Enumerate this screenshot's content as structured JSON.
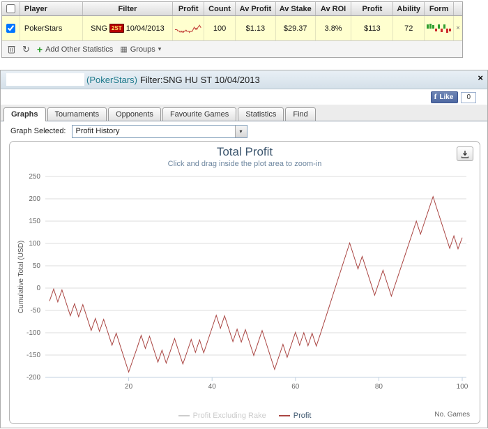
{
  "table": {
    "headers": [
      "",
      "Player",
      "Filter",
      "Profit",
      "Count",
      "Av Profit",
      "Av Stake",
      "Av ROI",
      "Profit",
      "Ability",
      "Form",
      ""
    ],
    "row": {
      "player": "PokerStars",
      "filter_prefix": "SNG",
      "filter_badge": "2ST",
      "filter_date": "10/04/2013",
      "count": "100",
      "av_profit": "$1.13",
      "av_stake": "$29.37",
      "av_roi": "3.8%",
      "profit": "$113",
      "ability": "72",
      "remove_label": "×",
      "form_bars": [
        6,
        7,
        5,
        -4,
        6,
        -5,
        6,
        -6,
        -4
      ]
    },
    "toolbar": {
      "refresh_icon": "↻",
      "groups_icon": "▦",
      "caret_icon": "▾",
      "plus_icon": "+",
      "add_label": "Add Other Statistics",
      "groups_label": "Groups"
    }
  },
  "window": {
    "title_site": "(PokerStars)",
    "title_filter": "Filter:SNG HU ST 10/04/2013",
    "close_label": "×",
    "like_f": "f",
    "like_label": "Like",
    "like_count": "0",
    "tabs": [
      "Graphs",
      "Tournaments",
      "Opponents",
      "Favourite Games",
      "Statistics",
      "Find"
    ],
    "graph_selected_label": "Graph Selected:",
    "graph_selected_value": "Profit History",
    "dropdown_arrow": "▾"
  },
  "colors": {
    "chart_line": "#AA4643",
    "hidden_legend": "#cccccc",
    "row_highlight": "#ffffcf",
    "title_teal": "#3E576F",
    "form_green": "#2f9e2f",
    "form_red": "#cc2a2a"
  },
  "chart_data": {
    "type": "line",
    "title": "Total Profit",
    "subtitle": "Click and drag inside the plot area to zoom-in",
    "ylabel": "Cumulative Total (USD)",
    "xlabel": "No. Games",
    "ylim": [
      -200,
      250
    ],
    "xlim": [
      0,
      101
    ],
    "yticks": [
      -200,
      -150,
      -100,
      -50,
      0,
      50,
      100,
      150,
      200,
      250
    ],
    "xticks": [
      20,
      40,
      60,
      80,
      100
    ],
    "grid": true,
    "legend_position": "bottom",
    "legend": [
      {
        "name": "Profit Excluding Rake",
        "color": "#cccccc",
        "hidden": true
      },
      {
        "name": "Profit",
        "color": "#AA4643",
        "hidden": false
      }
    ],
    "series": [
      {
        "name": "Profit",
        "color": "#AA4643",
        "x_start": 1,
        "x_step": 1,
        "values": [
          -29,
          -2,
          -31,
          -4,
          -33,
          -62,
          -35,
          -64,
          -37,
          -66,
          -95,
          -68,
          -97,
          -70,
          -99,
          -128,
          -101,
          -130,
          -159,
          -188,
          -161,
          -134,
          -106,
          -135,
          -108,
          -137,
          -166,
          -139,
          -168,
          -141,
          -113,
          -142,
          -170,
          -143,
          -115,
          -144,
          -116,
          -145,
          -117,
          -89,
          -61,
          -90,
          -62,
          -91,
          -120,
          -92,
          -121,
          -93,
          -122,
          -151,
          -123,
          -95,
          -124,
          -153,
          -182,
          -154,
          -126,
          -155,
          -127,
          -99,
          -128,
          -100,
          -129,
          -101,
          -130,
          -102,
          -73,
          -44,
          -15,
          14,
          43,
          72,
          101,
          72,
          43,
          71,
          42,
          13,
          -16,
          12,
          40,
          11,
          -18,
          10,
          38,
          66,
          94,
          122,
          150,
          121,
          149,
          177,
          205,
          176,
          147,
          118,
          89,
          117,
          88,
          113
        ]
      }
    ]
  }
}
